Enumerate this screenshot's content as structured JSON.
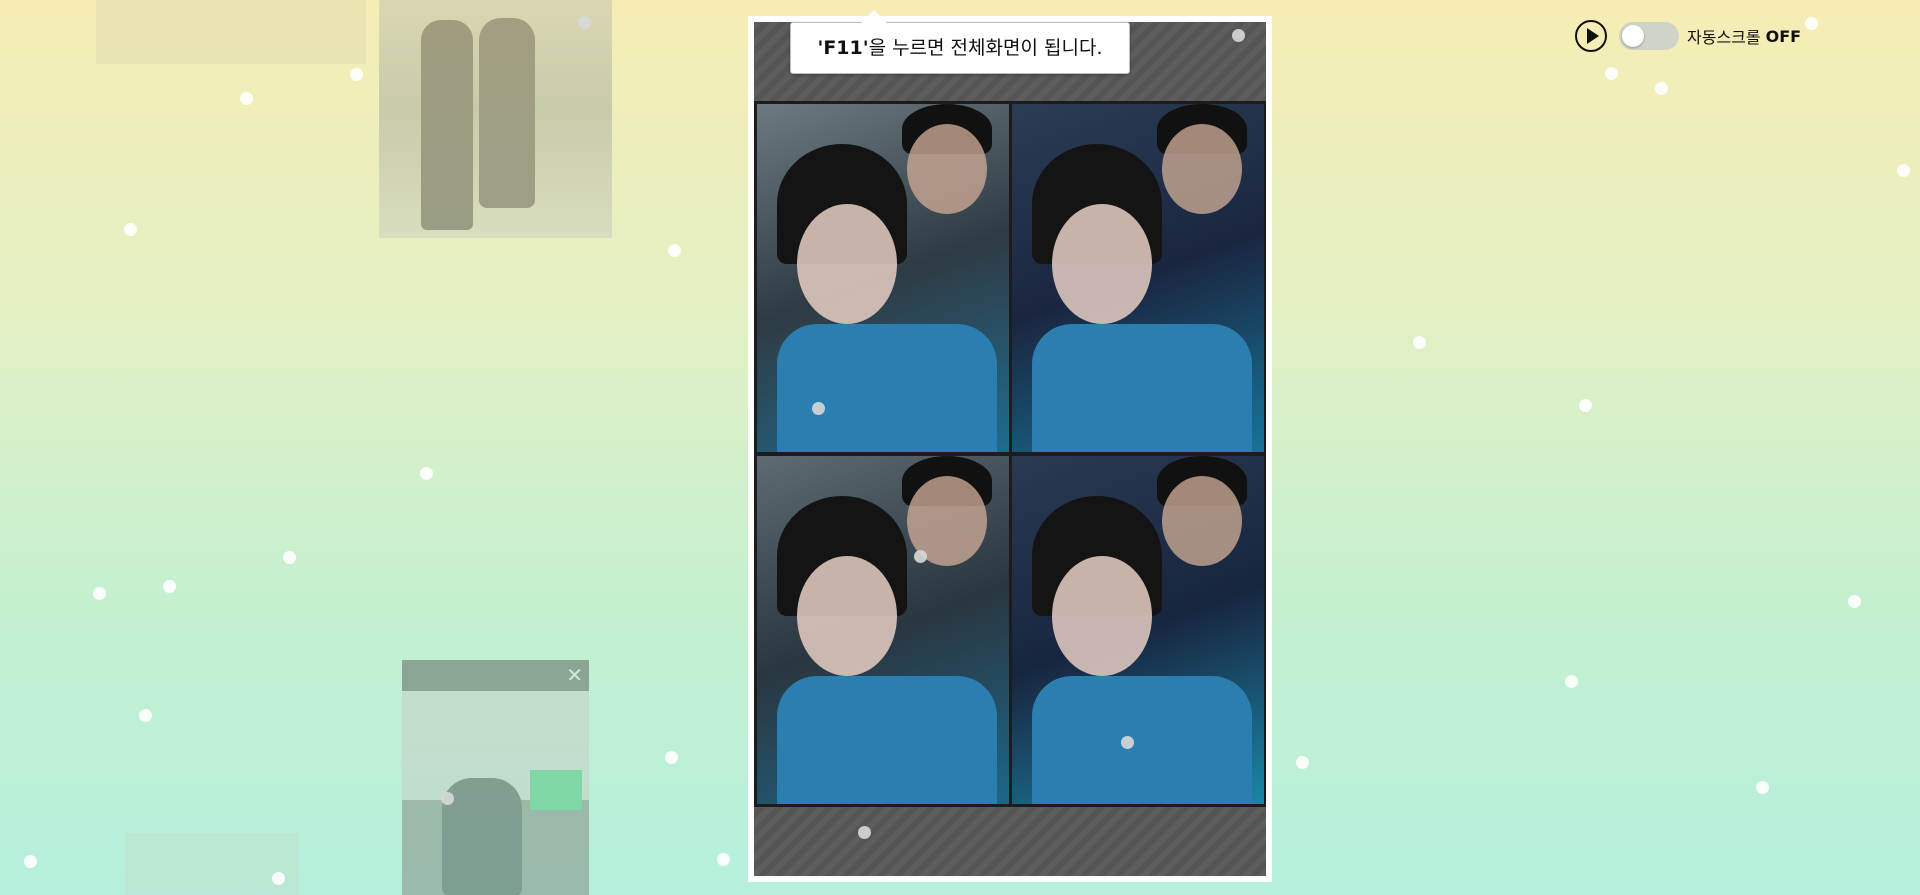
{
  "tooltip": {
    "key": "'F11'",
    "text": "을 누르면 전체화면이 됩니다."
  },
  "controls": {
    "toggle_label": "자동스크롤",
    "toggle_state": "OFF",
    "autoscroll_on": false
  },
  "icons": {
    "play": "play-icon",
    "close": "close-icon"
  },
  "colors": {
    "background_top": "#f6edb4",
    "background_bottom": "#b5f0dc",
    "viewer_frame": "#ffffff",
    "viewer_panel": "#5a5a5a"
  }
}
